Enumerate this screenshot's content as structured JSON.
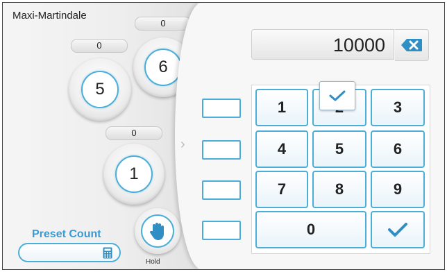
{
  "app": {
    "title": "Maxi-Martindale"
  },
  "dials": [
    {
      "counter": "0",
      "value": "6"
    },
    {
      "counter": "0",
      "value": "5"
    },
    {
      "counter": "0",
      "value": "1"
    }
  ],
  "hold": {
    "label": "Hold",
    "icon": "hand-icon"
  },
  "preset": {
    "label": "Preset Count",
    "value": "",
    "icon": "calculator-icon"
  },
  "display": {
    "value": "10000",
    "backspace_icon": "backspace-icon"
  },
  "keypad": {
    "keys": [
      "1",
      "2",
      "3",
      "4",
      "5",
      "6",
      "7",
      "8",
      "9",
      "0"
    ],
    "confirm_icon": "checkmark-icon"
  },
  "colors": {
    "accent": "#4aaed8",
    "text": "#222222"
  }
}
